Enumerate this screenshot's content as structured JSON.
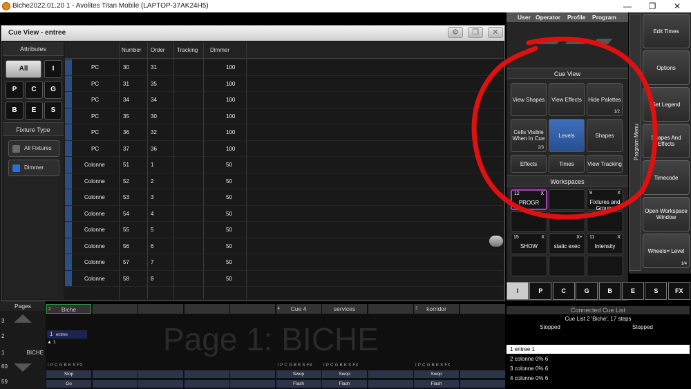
{
  "window": {
    "title": "Biche2022.01.20 1 - Avolites Titan Mobile (LAPTOP-37AK24H5)",
    "controls": [
      "—",
      "❐",
      "✕"
    ]
  },
  "cue_view": {
    "title": "Cue View - entree",
    "attributes_label": "Attributes",
    "attr_buttons": [
      "All",
      "I",
      "P",
      "C",
      "G",
      "B",
      "E",
      "S"
    ],
    "fixture_type_label": "Fixture Type",
    "fixture_buttons": [
      {
        "label": "All Fixtures",
        "color": "#6a6a6a"
      },
      {
        "label": "Dimmer",
        "color": "#2d6fd3"
      }
    ],
    "columns": [
      "Number",
      "Order",
      "Tracking",
      "Dimmer"
    ],
    "rows": [
      {
        "type": "PC",
        "number": "30",
        "order": "31",
        "tracking": "",
        "dimmer": "100"
      },
      {
        "type": "PC",
        "number": "31",
        "order": "35",
        "tracking": "",
        "dimmer": "100"
      },
      {
        "type": "PC",
        "number": "34",
        "order": "34",
        "tracking": "",
        "dimmer": "100"
      },
      {
        "type": "PC",
        "number": "35",
        "order": "30",
        "tracking": "",
        "dimmer": "100"
      },
      {
        "type": "PC",
        "number": "36",
        "order": "32",
        "tracking": "",
        "dimmer": "100"
      },
      {
        "type": "PC",
        "number": "37",
        "order": "36",
        "tracking": "",
        "dimmer": "100"
      },
      {
        "type": "Colonne",
        "number": "51",
        "order": "1",
        "tracking": "",
        "dimmer": "50"
      },
      {
        "type": "Colonne",
        "number": "52",
        "order": "2",
        "tracking": "",
        "dimmer": "50"
      },
      {
        "type": "Colonne",
        "number": "53",
        "order": "3",
        "tracking": "",
        "dimmer": "50"
      },
      {
        "type": "Colonne",
        "number": "54",
        "order": "4",
        "tracking": "",
        "dimmer": "50"
      },
      {
        "type": "Colonne",
        "number": "55",
        "order": "5",
        "tracking": "",
        "dimmer": "50"
      },
      {
        "type": "Colonne",
        "number": "56",
        "order": "6",
        "tracking": "",
        "dimmer": "50"
      },
      {
        "type": "Colonne",
        "number": "57",
        "order": "7",
        "tracking": "",
        "dimmer": "50"
      },
      {
        "type": "Colonne",
        "number": "58",
        "order": "8",
        "tracking": "",
        "dimmer": "50"
      }
    ]
  },
  "program_panel": {
    "user_tabs": [
      "User",
      "Operator",
      "Profile",
      "Program"
    ],
    "cue_view_title": "Cue View",
    "cue_view_buttons": [
      {
        "label": "View Shapes",
        "frac": "",
        "selected": false
      },
      {
        "label": "View Effects",
        "frac": "",
        "selected": false
      },
      {
        "label": "Hide Palettes",
        "frac": "1/2",
        "selected": false
      },
      {
        "label": "Cells Visible When In Cue",
        "frac": "2/3",
        "selected": false
      },
      {
        "label": "Levels",
        "frac": "",
        "selected": true
      },
      {
        "label": "Shapes",
        "frac": "",
        "selected": false
      },
      {
        "label": "Effects",
        "frac": "",
        "selected": false
      },
      {
        "label": "Times",
        "frac": "",
        "selected": false
      },
      {
        "label": "View Tracking",
        "frac": "",
        "selected": false
      }
    ],
    "workspaces_title": "Workspaces",
    "workspaces": [
      {
        "num": "12",
        "label": "PROGR",
        "x": "X",
        "highlight": true
      },
      {
        "num": "",
        "label": "",
        "x": "",
        "highlight": false
      },
      {
        "num": "9",
        "label": "Fixtures and Groups",
        "x": "X",
        "highlight": false
      },
      {
        "num": "",
        "label": "",
        "x": "",
        "highlight": false
      },
      {
        "num": "",
        "label": "",
        "x": "",
        "highlight": false
      },
      {
        "num": "",
        "label": "",
        "x": "",
        "highlight": false
      },
      {
        "num": "15",
        "label": "SHOW",
        "x": "X",
        "highlight": false
      },
      {
        "num": "",
        "label": "static exec",
        "x": "X+",
        "highlight": false
      },
      {
        "num": "11",
        "label": "Intensity",
        "x": "X",
        "highlight": false
      },
      {
        "num": "",
        "label": "",
        "x": "",
        "highlight": false
      },
      {
        "num": "",
        "label": "",
        "x": "",
        "highlight": false
      },
      {
        "num": "",
        "label": "",
        "x": "",
        "highlight": false
      }
    ]
  },
  "program_menu": {
    "tab_label": "Program Menu",
    "buttons": [
      {
        "label": "Edit Times",
        "frac": ""
      },
      {
        "label": "Options",
        "frac": ""
      },
      {
        "label": "Set Legend",
        "frac": ""
      },
      {
        "label": "Shapes And Effects",
        "frac": ""
      },
      {
        "label": "Timecode",
        "frac": ""
      },
      {
        "label": "Open Workspace Window",
        "frac": ""
      },
      {
        "label": "Wheels= Level",
        "frac": "1/4"
      }
    ]
  },
  "attribute_row": [
    "I",
    "P",
    "C",
    "G",
    "B",
    "E",
    "S",
    "FX"
  ],
  "pages": {
    "label": "Pages",
    "rows": [
      {
        "n": "3",
        "name": ""
      },
      {
        "n": "2",
        "name": ""
      },
      {
        "n": "1",
        "name": "BICHE"
      },
      {
        "n": "60",
        "name": ""
      },
      {
        "n": "59",
        "name": ""
      }
    ]
  },
  "playbacks": {
    "big_page_title": "Page 1: BICHE",
    "headers": [
      {
        "num": "2",
        "label": "Biche",
        "highlight": true
      },
      {
        "num": "",
        "label": "",
        "highlight": false
      },
      {
        "num": "",
        "label": "",
        "highlight": false
      },
      {
        "num": "",
        "label": "",
        "highlight": false
      },
      {
        "num": "",
        "label": "",
        "highlight": false
      },
      {
        "num": "4",
        "label": "Cue 4",
        "highlight": false
      },
      {
        "num": "",
        "label": "services",
        "highlight": false
      },
      {
        "num": "",
        "label": "",
        "highlight": false
      },
      {
        "num": "3",
        "label": "korridor",
        "highlight": false
      },
      {
        "num": "",
        "label": "",
        "highlight": false
      }
    ],
    "cue_box": {
      "num": "1",
      "label": "entree"
    },
    "cue_next": "1",
    "attr_strip": "I P C G B E S FX",
    "top_buttons": [
      "Stop",
      "",
      "",
      "",
      "",
      "Swop",
      "Swop",
      "",
      "Swop",
      ""
    ],
    "bottom_buttons": [
      "Go",
      "",
      "",
      "",
      "",
      "Flash",
      "Flash",
      "",
      "Flash",
      ""
    ]
  },
  "cue_list": {
    "title": "Connected Cue List",
    "subtitle": "Cue List 2 'Biche', 17 steps",
    "status_left": "Stopped",
    "status_right": "Stopped",
    "rows": [
      "1  entree  1",
      "2  colonne 0%  6",
      "3  colonne 0%  6",
      "4  colonne 0%  6"
    ]
  }
}
